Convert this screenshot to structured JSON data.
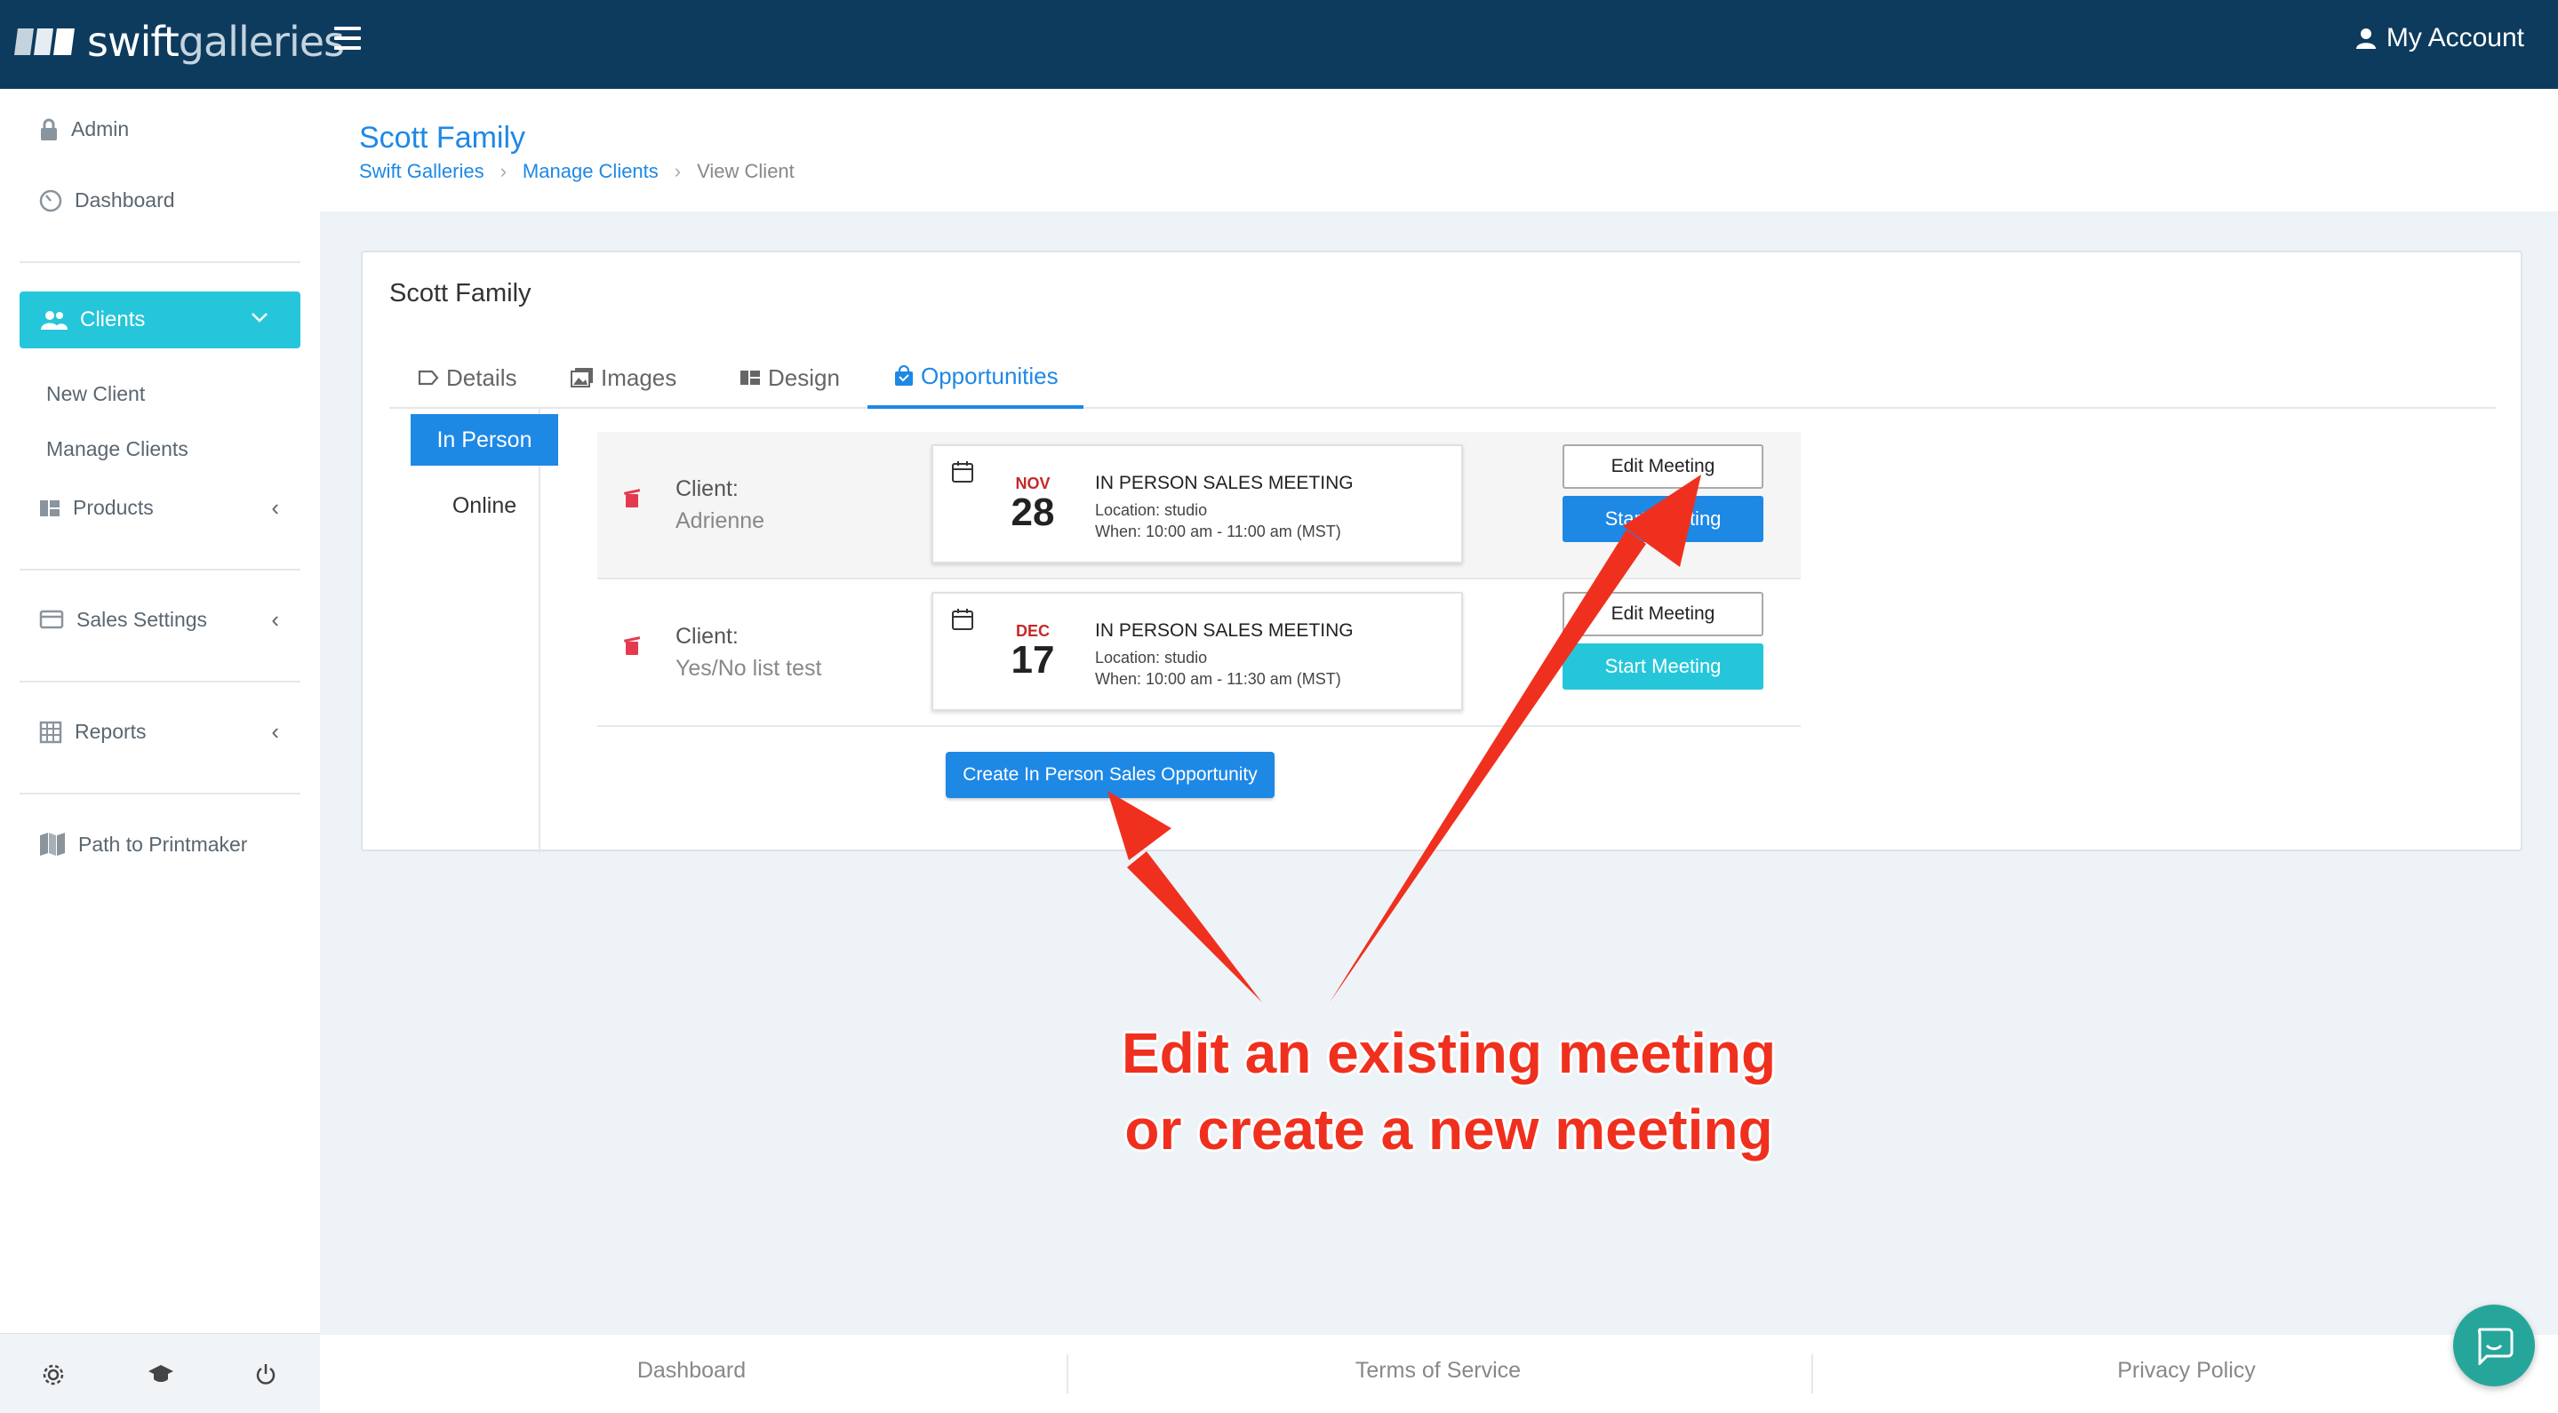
{
  "app": {
    "brand_bold": "swift",
    "brand_light": "galleries",
    "account_label": "My Account"
  },
  "sidebar": {
    "admin": "Admin",
    "dashboard": "Dashboard",
    "clients": "Clients",
    "new_client": "New Client",
    "manage_clients": "Manage Clients",
    "products": "Products",
    "sales_settings": "Sales Settings",
    "reports": "Reports",
    "path_to_printmaker": "Path to Printmaker"
  },
  "header": {
    "title": "Scott Family",
    "breadcrumb": [
      "Swift Galleries",
      "Manage Clients",
      "View Client"
    ]
  },
  "card": {
    "title": "Scott Family",
    "tabs": [
      "Details",
      "Images",
      "Design",
      "Opportunities"
    ],
    "active_tab": "Opportunities",
    "subtabs": [
      "In Person",
      "Online"
    ],
    "active_subtab": "In Person"
  },
  "opportunities": [
    {
      "client_label": "Client:",
      "client_name": "Adrienne",
      "month": "NOV",
      "day": "28",
      "title": "IN PERSON SALES MEETING",
      "location": "Location: studio",
      "when": "When: 10:00 am - 11:00 am (MST)",
      "edit_label": "Edit Meeting",
      "start_label": "Start Meeting",
      "start_color": "#1e88e5"
    },
    {
      "client_label": "Client:",
      "client_name": "Yes/No list test",
      "month": "DEC",
      "day": "17",
      "title": "IN PERSON SALES MEETING",
      "location": "Location: studio",
      "when": "When: 10:00 am - 11:30 am (MST)",
      "edit_label": "Edit Meeting",
      "start_label": "Start Meeting",
      "start_color": "#26c6da"
    }
  ],
  "create_button": "Create In Person Sales Opportunity",
  "annotation": {
    "line1": "Edit an existing meeting",
    "line2": "or create a new meeting",
    "color": "#f0301e"
  },
  "footer": {
    "links": [
      "Dashboard",
      "Terms of Service",
      "Privacy Policy"
    ]
  },
  "colors": {
    "topbar": "#0d3b5e",
    "accent": "#1e88e5",
    "active_nav": "#26c6da"
  }
}
